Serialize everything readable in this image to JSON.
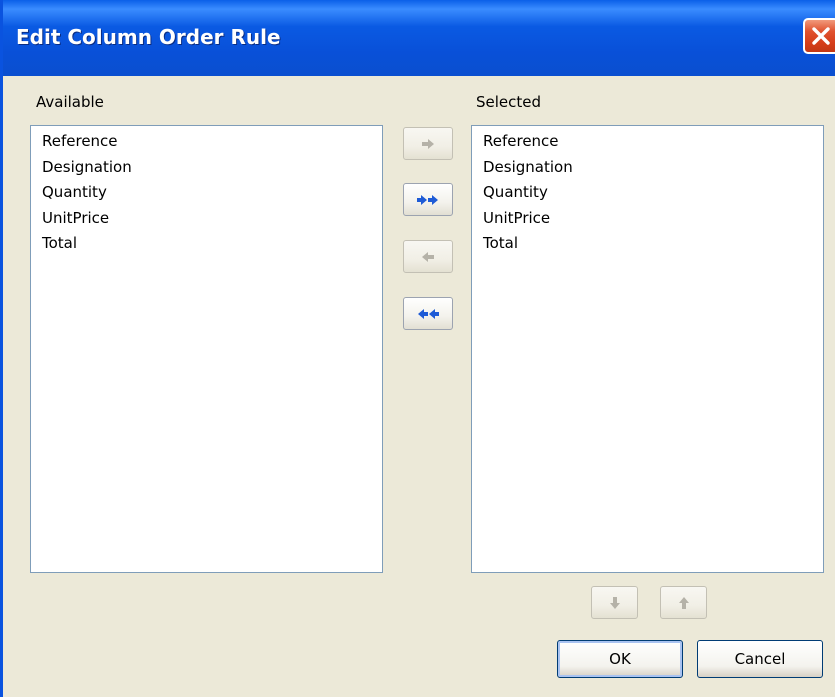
{
  "window": {
    "title": "Edit Column Order Rule"
  },
  "available": {
    "label": "Available",
    "items": [
      "Reference",
      "Designation",
      "Quantity",
      "UnitPrice",
      "Total"
    ]
  },
  "selected": {
    "label": "Selected",
    "items": [
      "Reference",
      "Designation",
      "Quantity",
      "UnitPrice",
      "Total"
    ]
  },
  "transfer_buttons": {
    "add": {
      "icon": "arrow-right-icon",
      "enabled": false
    },
    "add_all": {
      "icon": "double-arrow-right-icon",
      "enabled": true
    },
    "remove": {
      "icon": "arrow-left-icon",
      "enabled": false
    },
    "remove_all": {
      "icon": "double-arrow-left-icon",
      "enabled": true
    }
  },
  "order_buttons": {
    "move_down": {
      "icon": "arrow-down-icon",
      "enabled": false
    },
    "move_up": {
      "icon": "arrow-up-icon",
      "enabled": false
    }
  },
  "footer": {
    "ok_label": "OK",
    "cancel_label": "Cancel"
  },
  "colors": {
    "titlebar": "#0A5AE3",
    "dialog_bg": "#ECE9D8",
    "list_border": "#7F9DB9",
    "icon_enabled": "#1E5BD6",
    "icon_disabled": "#B5B2A8",
    "close_button": "#D63E1A"
  }
}
